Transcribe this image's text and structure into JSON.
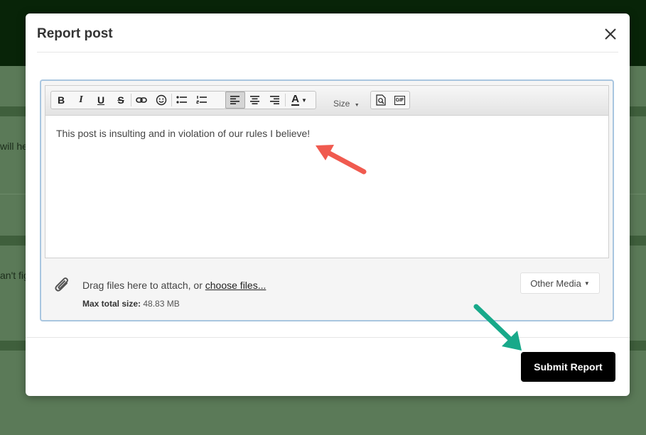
{
  "background": {
    "snippet_1": "will hel",
    "snippet_2": "an't fig"
  },
  "modal": {
    "title": "Report post",
    "close_icon": "close-icon"
  },
  "toolbar": {
    "buttons": [
      {
        "label": "B",
        "name": "bold"
      },
      {
        "label": "I",
        "name": "italic"
      },
      {
        "label": "U",
        "name": "underline"
      },
      {
        "label": "S",
        "name": "strikethrough"
      },
      {
        "icon": "link-icon"
      },
      {
        "icon": "smiley-icon"
      },
      {
        "icon": "bullet-list-icon"
      },
      {
        "icon": "numbered-list-icon"
      },
      {
        "icon": "align-left-icon",
        "active": true
      },
      {
        "icon": "align-center-icon"
      },
      {
        "icon": "align-right-icon"
      },
      {
        "label": "A",
        "icon": "font-color-icon"
      },
      {
        "icon": "preview-icon"
      },
      {
        "label": "GIF",
        "icon": "gif-icon"
      }
    ],
    "size_label": "Size"
  },
  "editor": {
    "content": "This post is insulting and in violation of our rules I believe!"
  },
  "attachments": {
    "drag_text": "Drag files here to attach, or ",
    "choose_link": "choose files...",
    "max_label": "Max total size:",
    "max_value": "48.83 MB",
    "other_media_label": "Other Media"
  },
  "footer": {
    "submit_label": "Submit Report"
  },
  "colors": {
    "accent_arrow_red": "#f05a4f",
    "accent_arrow_green": "#18a98a",
    "submit_bg": "#000000"
  }
}
